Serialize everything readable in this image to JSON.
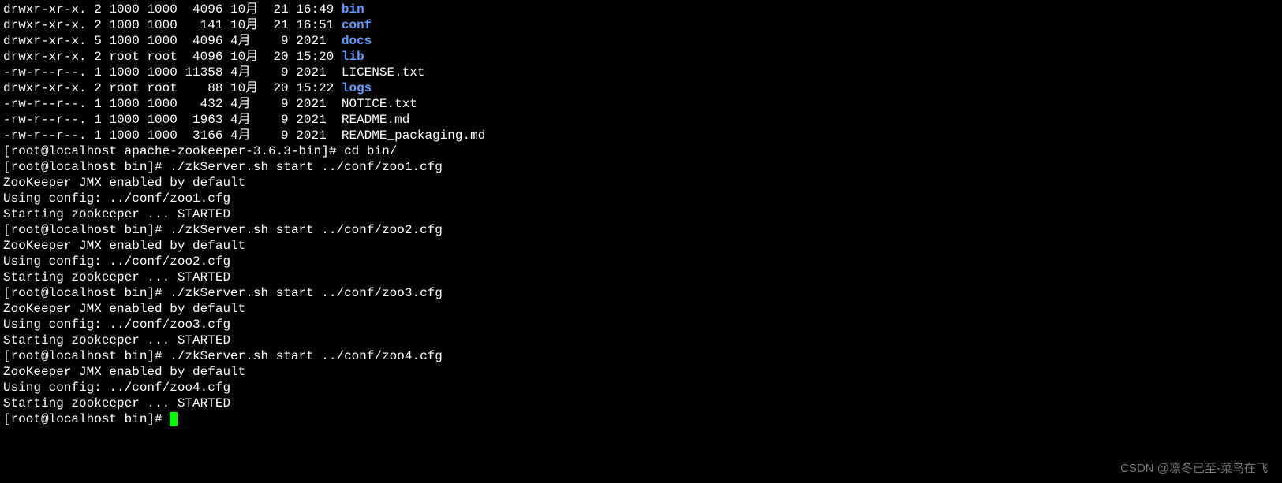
{
  "listing": [
    {
      "perm": "drwxr-xr-x.",
      "links": "2",
      "owner": "1000",
      "group": "1000",
      "size": "4096",
      "mon": "10月",
      "day": "21",
      "time": "16:49",
      "name": "bin",
      "dir": true
    },
    {
      "perm": "drwxr-xr-x.",
      "links": "2",
      "owner": "1000",
      "group": "1000",
      "size": "141",
      "mon": "10月",
      "day": "21",
      "time": "16:51",
      "name": "conf",
      "dir": true
    },
    {
      "perm": "drwxr-xr-x.",
      "links": "5",
      "owner": "1000",
      "group": "1000",
      "size": "4096",
      "mon": "4月",
      "day": "9",
      "time": "2021",
      "name": "docs",
      "dir": true
    },
    {
      "perm": "drwxr-xr-x.",
      "links": "2",
      "owner": "root",
      "group": "root",
      "size": "4096",
      "mon": "10月",
      "day": "20",
      "time": "15:20",
      "name": "lib",
      "dir": true
    },
    {
      "perm": "-rw-r--r--.",
      "links": "1",
      "owner": "1000",
      "group": "1000",
      "size": "11358",
      "mon": "4月",
      "day": "9",
      "time": "2021",
      "name": "LICENSE.txt",
      "dir": false
    },
    {
      "perm": "drwxr-xr-x.",
      "links": "2",
      "owner": "root",
      "group": "root",
      "size": "88",
      "mon": "10月",
      "day": "20",
      "time": "15:22",
      "name": "logs",
      "dir": true
    },
    {
      "perm": "-rw-r--r--.",
      "links": "1",
      "owner": "1000",
      "group": "1000",
      "size": "432",
      "mon": "4月",
      "day": "9",
      "time": "2021",
      "name": "NOTICE.txt",
      "dir": false
    },
    {
      "perm": "-rw-r--r--.",
      "links": "1",
      "owner": "1000",
      "group": "1000",
      "size": "1963",
      "mon": "4月",
      "day": "9",
      "time": "2021",
      "name": "README.md",
      "dir": false
    },
    {
      "perm": "-rw-r--r--.",
      "links": "1",
      "owner": "1000",
      "group": "1000",
      "size": "3166",
      "mon": "4月",
      "day": "9",
      "time": "2021",
      "name": "README_packaging.md",
      "dir": false
    }
  ],
  "prompts": {
    "p0": "[root@localhost apache-zookeeper-3.6.3-bin]# ",
    "c0": "cd bin/",
    "pb": "[root@localhost bin]# ",
    "cmd1": "./zkServer.sh start ../conf/zoo1.cfg",
    "cmd2": "./zkServer.sh start ../conf/zoo2.cfg",
    "cmd3": "./zkServer.sh start ../conf/zoo3.cfg",
    "cmd4": "./zkServer.sh start ../conf/zoo4.cfg"
  },
  "out": {
    "jmx": "ZooKeeper JMX enabled by default",
    "u1": "Using config: ../conf/zoo1.cfg",
    "u2": "Using config: ../conf/zoo2.cfg",
    "u3": "Using config: ../conf/zoo3.cfg",
    "u4": "Using config: ../conf/zoo4.cfg",
    "started": "Starting zookeeper ... STARTED"
  },
  "watermark": "CSDN @凛冬已至-菜鸟在飞"
}
